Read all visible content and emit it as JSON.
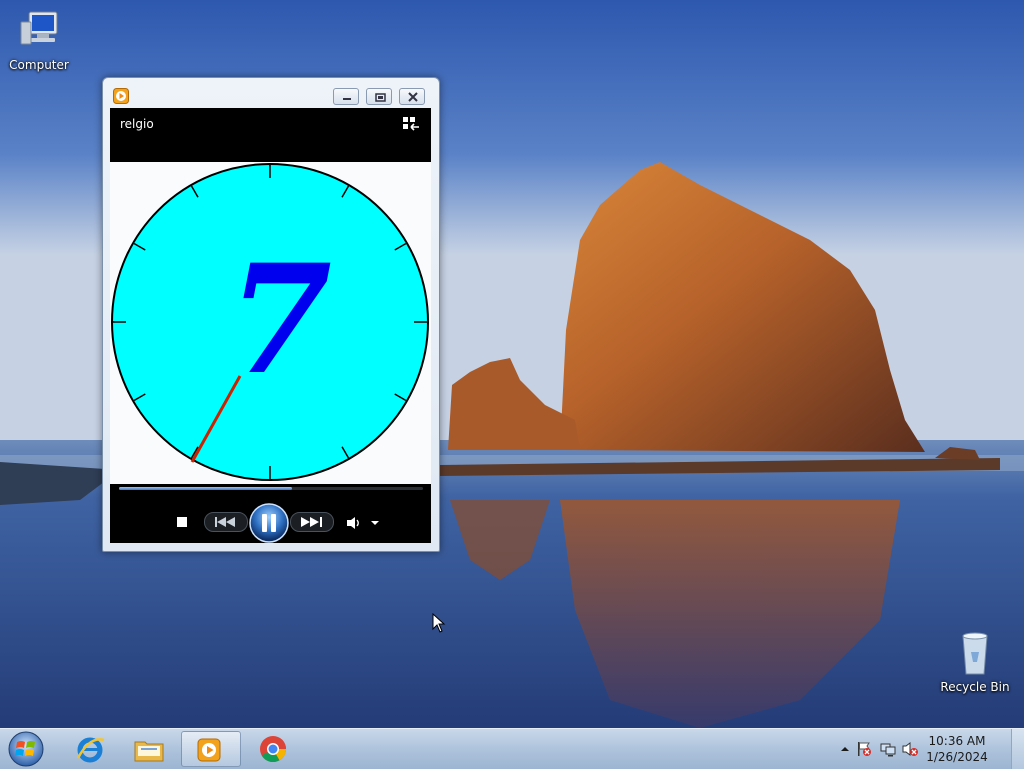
{
  "desktop": {
    "icons": [
      {
        "label": "Computer",
        "icon": "computer-icon"
      },
      {
        "label": "Recycle Bin",
        "icon": "recycle-bin-icon"
      }
    ]
  },
  "media_player": {
    "title_bar": {
      "app_icon": "media-player-icon",
      "buttons": [
        "minimize-icon",
        "restore-icon",
        "close-icon"
      ]
    },
    "now_playing": "relgio",
    "video": {
      "clock_digit": "7",
      "face_color": "#00ffff",
      "digit_color": "#0000ee",
      "hand_color": "#cc2200",
      "tick_count": 12
    },
    "seek_progress": 0.57,
    "controls": [
      "stop-icon",
      "previous-icon",
      "pause-icon",
      "next-icon",
      "volume-icon",
      "volume-menu-chevron-icon"
    ]
  },
  "taskbar": {
    "pinned": [
      {
        "name": "internet-explorer",
        "icon": "internet-explorer-icon"
      },
      {
        "name": "windows-explorer",
        "icon": "folder-icon"
      },
      {
        "name": "windows-media-player",
        "icon": "media-player-icon",
        "active": true
      },
      {
        "name": "google-chrome",
        "icon": "chrome-icon"
      }
    ],
    "tray": {
      "icons": [
        "show-hidden-icons-chevron-icon",
        "action-center-flag-icon",
        "network-icon",
        "volume-muted-icon"
      ],
      "time": "10:36 AM",
      "date": "1/26/2024"
    }
  }
}
